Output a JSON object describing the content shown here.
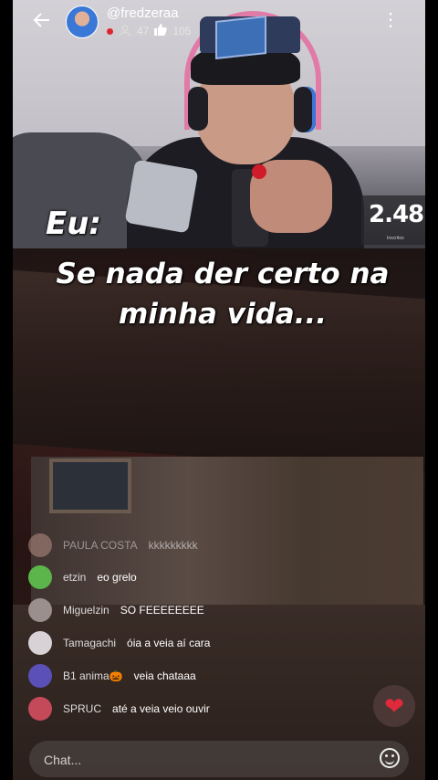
{
  "header": {
    "username": "@fredzeraa",
    "viewers": "47",
    "likes": "105"
  },
  "video": {
    "counter": "2.48",
    "counter_sub": "Inscritos"
  },
  "captions": {
    "eu": "Eu:",
    "main": "Se nada der certo na minha vida..."
  },
  "chat": {
    "messages": [
      {
        "name": "PAULA COSTA",
        "text": "kkkkkkkkk",
        "avatar_color": "#b88f86"
      },
      {
        "name": "etzin",
        "text": "eo grelo",
        "avatar_color": "#5bb54a"
      },
      {
        "name": "Miguelzin",
        "text": "SO FEEEEEEEE",
        "avatar_color": "#9a8f8c"
      },
      {
        "name": "Tamagachi",
        "text": "óia a veia aí cara",
        "avatar_color": "#d8d2d6"
      },
      {
        "name": "B1 anima🎃",
        "text": "veia chataaa",
        "avatar_color": "#5b4fb8"
      },
      {
        "name": "SPRUC",
        "text": "até a veia veio ouvir",
        "avatar_color": "#c44a5a"
      }
    ],
    "placeholder": "Chat..."
  },
  "icons": {
    "back": "arrow-left-icon",
    "menu": "kebab-menu-icon",
    "viewers": "user-icon",
    "likes": "thumbs-up-icon",
    "heart": "heart-icon",
    "emoji": "smiley-icon"
  },
  "colors": {
    "live": "#e0242f",
    "heart": "#e02a3b"
  }
}
